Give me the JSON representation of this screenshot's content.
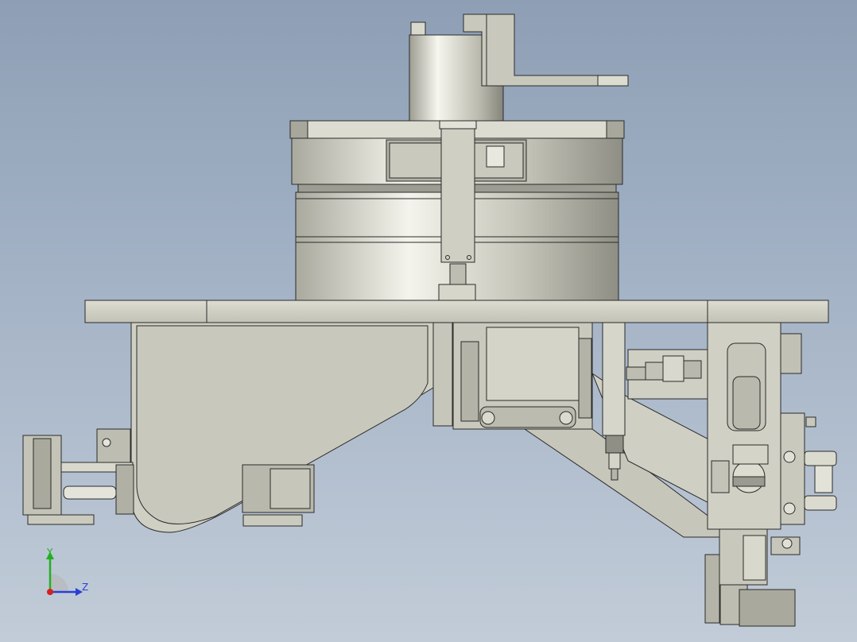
{
  "triad": {
    "y_label": "Y",
    "z_label": "Z",
    "colors": {
      "y": "#22b022",
      "z": "#2a3fd8",
      "x": "#d82020"
    }
  },
  "palette": {
    "metal_light": "#e6e6dc",
    "metal_mid": "#c9c9bd",
    "metal_dark": "#8a8a80",
    "plate": "#d3d3c9",
    "edge": "#2b2b2b"
  }
}
